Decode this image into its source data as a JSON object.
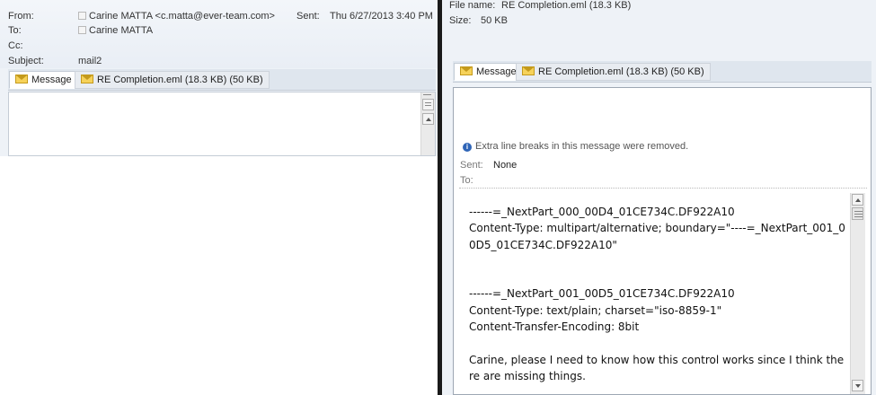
{
  "left_window": {
    "header": {
      "from_label": "From:",
      "from_value": "Carine MATTA <c.matta@ever-team.com>",
      "sent_label": "Sent:",
      "sent_value": "Thu 6/27/2013 3:40 PM",
      "to_label": "To:",
      "to_value": "Carine MATTA",
      "cc_label": "Cc:",
      "subject_label": "Subject:",
      "subject_value": "mail2"
    },
    "tabs": {
      "message": "Message",
      "attachment": "RE Completion.eml (18.3 KB) (50 KB)"
    }
  },
  "right_window": {
    "file_info": {
      "file_name_label": "File name:",
      "file_name_value": "RE Completion.eml (18.3 KB)",
      "size_label": "Size:",
      "size_value": "50 KB"
    },
    "tabs": {
      "message": "Message",
      "attachment": "RE Completion.eml (18.3 KB) (50 KB)"
    },
    "info_bar": "Extra line breaks in this message were removed.",
    "sent_label": "Sent:",
    "sent_value": "None",
    "to_label": "To:",
    "body_lines": [
      "------=_NextPart_000_00D4_01CE734C.DF922A10",
      "Content-Type: multipart/alternative; boundary=\"----=_NextPart_001_00D5_01CE734C.DF922A10\"",
      "",
      "",
      "------=_NextPart_001_00D5_01CE734C.DF922A10",
      "Content-Type: text/plain; charset=\"iso-8859-1\"",
      "Content-Transfer-Encoding: 8bit",
      "",
      "Carine, please I need to know how this control works since I think there are missing things."
    ]
  },
  "colors": {
    "header_bg": "#eef2f7",
    "info_icon": "#2f65b7",
    "envelope": "#f6d25a",
    "divider": "#1a1a1a"
  }
}
